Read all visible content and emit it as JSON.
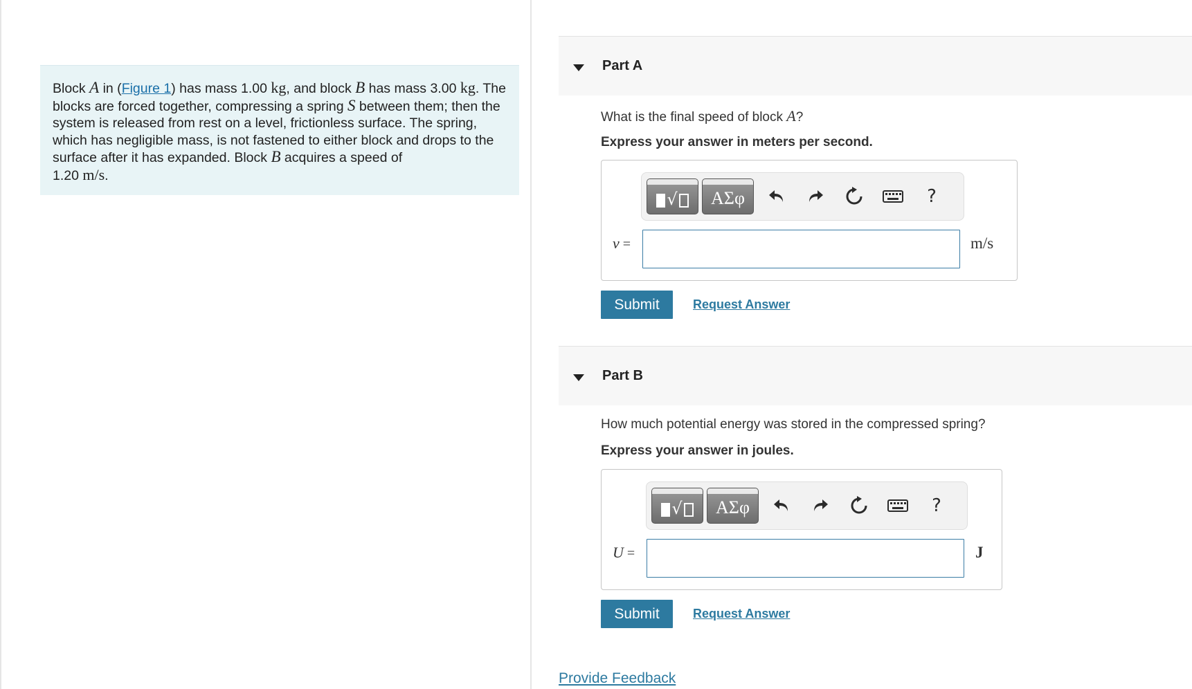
{
  "problem": {
    "t1": "Block ",
    "varA": "A",
    "t2": " in (",
    "figure_link": "Figure 1",
    "t3": ") has mass 1.00 ",
    "unit_kg": "kg",
    "t4": ", and block ",
    "varB": "B",
    "t5": " has mass 3.00 ",
    "t6": ". The blocks are forced together, compressing a spring ",
    "varS": "S",
    "t7": " between them; then the system is released from rest on a level, frictionless surface. The spring, which has negligible mass, is not fastened to either block and drops to the surface after it has expanded. Block ",
    "t8": " acquires a speed of ",
    "speed_value": "1.20 ",
    "speed_unit": "m/s",
    "t9": "."
  },
  "parts": [
    {
      "title": "Part A",
      "question_text": "What is the final speed of block ",
      "question_var": "A",
      "question_end": "?",
      "instruction": "Express your answer in meters per second.",
      "var_label": "v",
      "equals": " =",
      "unit": "m/s",
      "input_value": "",
      "submit_label": "Submit",
      "request_label": "Request Answer"
    },
    {
      "title": "Part B",
      "question_text": "How much potential energy was stored in the compressed spring?",
      "instruction": "Express your answer in joules.",
      "var_label": "U",
      "equals": " =",
      "unit": "J",
      "input_value": "",
      "submit_label": "Submit",
      "request_label": "Request Answer"
    }
  ],
  "toolbar": {
    "greek_label": "ΑΣφ",
    "help_label": "?",
    "icons": [
      "templates-icon",
      "greek-symbols-icon",
      "undo-icon",
      "redo-icon",
      "reset-icon",
      "keyboard-icon",
      "help-icon"
    ]
  },
  "feedback_label": "Provide Feedback",
  "colors": {
    "problem_bg": "#e8f4f6",
    "accent": "#2d7aa0",
    "part_header_bg": "#f7f7f7",
    "input_border": "#3a7ca5"
  }
}
